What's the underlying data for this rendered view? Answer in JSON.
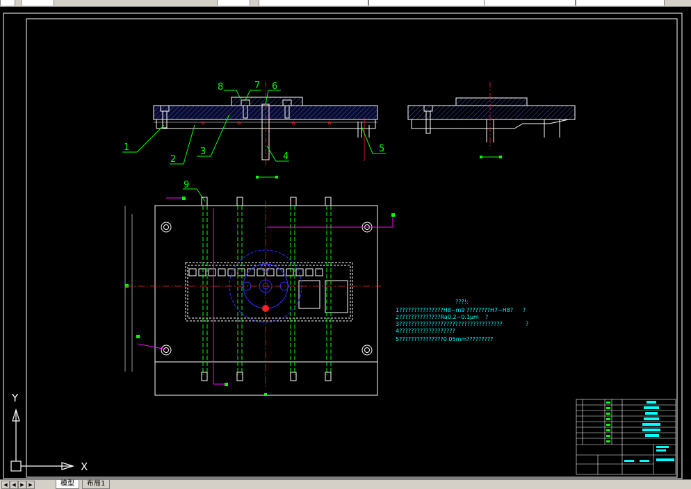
{
  "toolbar": {
    "cells": [
      "",
      "",
      "",
      "",
      "",
      ""
    ]
  },
  "drawing": {
    "part_numbers": [
      "1",
      "2",
      "3",
      "4",
      "5",
      "6",
      "7",
      "8",
      "9"
    ],
    "notes_title": "???!:",
    "notes": [
      "1???????????????H8~m9  ????????H7~H8?",
      "2??????????????Ra0.2~0.1μm",
      "3???????????????????????????????????",
      "4???????????????????",
      "5???????????????0.05mm?????????"
    ],
    "notes_side_marks": [
      "?",
      "?",
      "?"
    ],
    "ucs": {
      "x_label": "X",
      "y_label": "Y"
    }
  },
  "tabs": {
    "items": [
      {
        "label": "模型",
        "active": true
      },
      {
        "label": "布局1",
        "active": false
      }
    ]
  },
  "colors": {
    "background": "#000000",
    "frame": "#ffffff",
    "leader": "#00ff00",
    "center": "#ff0000",
    "dim_cyan": "#00ffff",
    "magenta": "#ff00ff",
    "blue": "#3030ff"
  }
}
